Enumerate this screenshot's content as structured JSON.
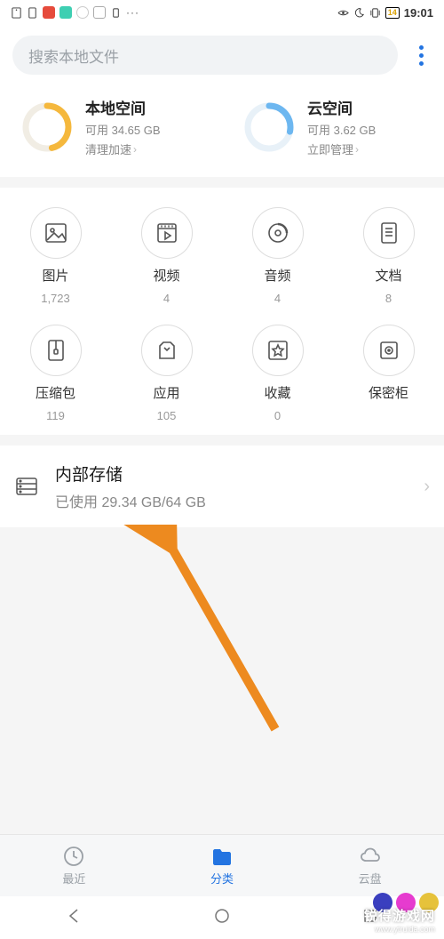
{
  "status": {
    "battery": "14",
    "time": "19:01"
  },
  "search": {
    "placeholder": "搜索本地文件"
  },
  "local": {
    "title": "本地空间",
    "available": "可用 34.65 GB",
    "action": "清理加速",
    "ring_color": "#f5b83d",
    "percent": 46
  },
  "cloud": {
    "title": "云空间",
    "available": "可用 3.62 GB",
    "action": "立即管理",
    "ring_color": "#6db7f0",
    "percent": 28
  },
  "categories": [
    {
      "key": "images",
      "label": "图片",
      "count": "1,723"
    },
    {
      "key": "video",
      "label": "视频",
      "count": "4"
    },
    {
      "key": "audio",
      "label": "音频",
      "count": "4"
    },
    {
      "key": "docs",
      "label": "文档",
      "count": "8"
    },
    {
      "key": "archives",
      "label": "压缩包",
      "count": "119"
    },
    {
      "key": "apps",
      "label": "应用",
      "count": "105"
    },
    {
      "key": "fav",
      "label": "收藏",
      "count": "0"
    },
    {
      "key": "safe",
      "label": "保密柜",
      "count": ""
    }
  ],
  "internal": {
    "title": "内部存储",
    "usage": "已使用 29.34 GB/64 GB"
  },
  "tabs": {
    "recent": "最近",
    "category": "分类",
    "cloud": "云盘"
  },
  "watermark": {
    "main": "锐得游戏网",
    "sub": "www.ytruida.com"
  },
  "arrow_color": "#ed8a1f"
}
